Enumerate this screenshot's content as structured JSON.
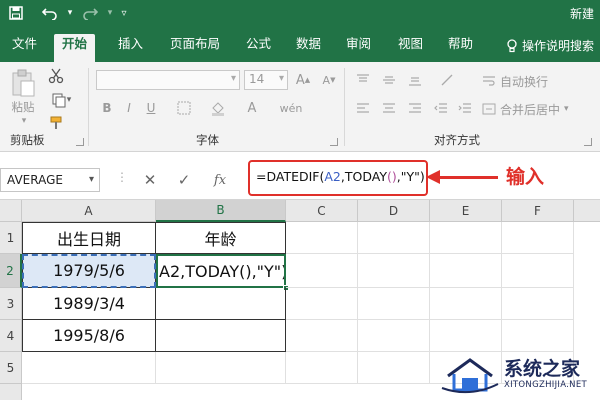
{
  "window": {
    "title": "新建"
  },
  "qat": {
    "save_icon": "save-icon",
    "undo_icon": "undo-icon",
    "redo_icon": "redo-icon",
    "customize_icon": "chevron-down-icon"
  },
  "tabs": [
    {
      "label": "文件"
    },
    {
      "label": "开始"
    },
    {
      "label": "插入"
    },
    {
      "label": "页面布局"
    },
    {
      "label": "公式"
    },
    {
      "label": "数据"
    },
    {
      "label": "审阅"
    },
    {
      "label": "视图"
    },
    {
      "label": "帮助"
    }
  ],
  "tell_me": {
    "label": "操作说明搜索"
  },
  "ribbon": {
    "clipboard": {
      "paste_label": "粘贴",
      "group_label": "剪贴板"
    },
    "font": {
      "size_value": "14",
      "group_label": "字体"
    },
    "alignment": {
      "wrap_label": "自动换行",
      "merge_label": "合并后居中",
      "group_label": "对齐方式"
    }
  },
  "formula_bar": {
    "name_box": "AVERAGE",
    "formula_prefix": "=DATEDIF(",
    "formula_ref": "A2",
    "formula_mid": ",TODAY",
    "formula_parens": "()",
    "formula_suffix": ",\"Y\")"
  },
  "annotation": {
    "text": "输入",
    "color": "#e0302a"
  },
  "sheet": {
    "columns": [
      "A",
      "B",
      "C",
      "D",
      "E",
      "F"
    ],
    "rows": [
      "1",
      "2",
      "3",
      "4",
      "5"
    ],
    "cells": {
      "A1": "出生日期",
      "B1": "年龄",
      "A2": "1979/5/6",
      "B2": "A2,TODAY(),\"Y\")",
      "A3": "1989/3/4",
      "A4": "1995/8/6"
    }
  },
  "watermark": {
    "brand": "系统之家",
    "url": "XITONGZHIJIA.NET"
  },
  "colors": {
    "accent": "#217346",
    "highlight": "#e0302a"
  }
}
